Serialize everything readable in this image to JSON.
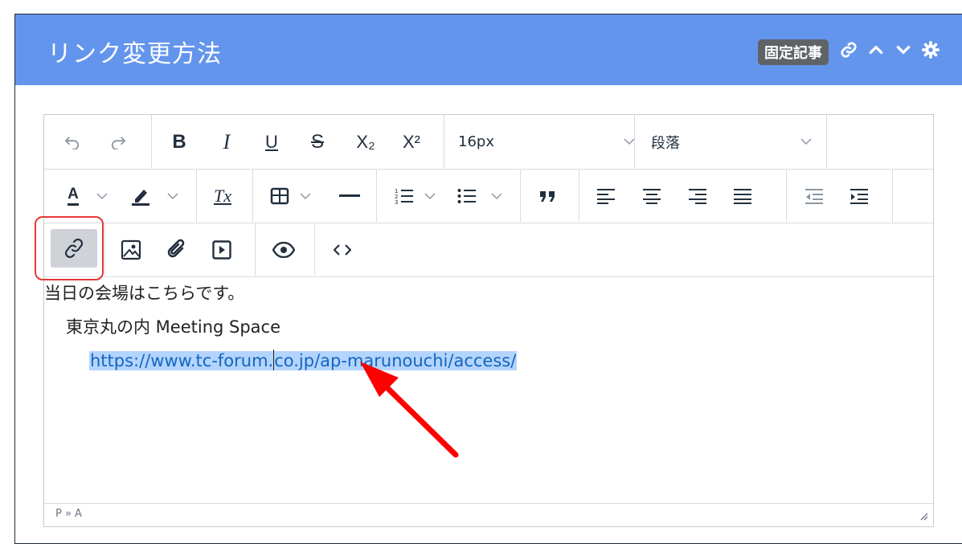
{
  "panel": {
    "title": "リンク変更方法",
    "badge": "固定記事",
    "tools": [
      "link-icon",
      "chevron-up-icon",
      "chevron-down-icon",
      "gear-icon"
    ]
  },
  "toolbar": {
    "row1": {
      "bold": "B",
      "italic": "I",
      "underline": "U",
      "strikethrough": "S",
      "subscript": "X₂",
      "superscript": "X²",
      "font_size": "16px",
      "block_format": "段落"
    },
    "row2": {
      "text_color": "A",
      "clear_format": "Tx"
    },
    "row3": {
      "link_active": true
    }
  },
  "content": {
    "line1": "当日の会場はこちらです。",
    "line2": "東京丸の内 Meeting Space",
    "link_part1": "https://www.tc-forum.",
    "link_part2": "co.jp/ap-marunouchi/access/"
  },
  "statusbar": {
    "path": "P » A"
  },
  "colors": {
    "header": "#6495ed",
    "highlight": "#b3d4fc",
    "annotation": "#e53935"
  }
}
